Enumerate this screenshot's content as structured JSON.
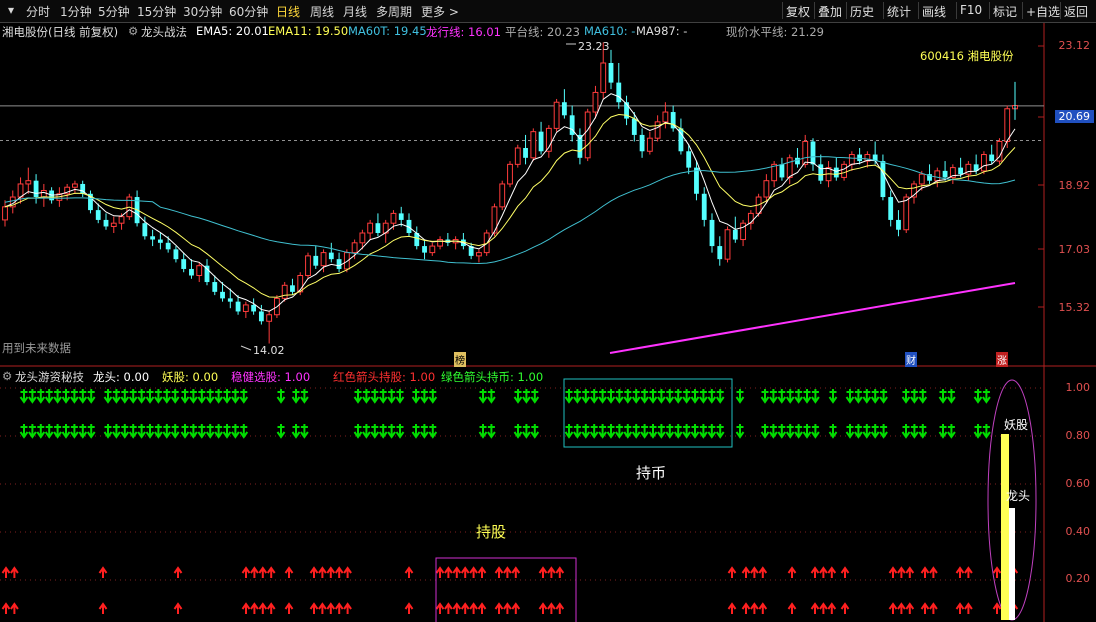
{
  "toolbar": {
    "periods": [
      "分时",
      "1分钟",
      "5分钟",
      "15分钟",
      "30分钟",
      "60分钟",
      "日线",
      "周线",
      "月线",
      "多周期",
      "更多"
    ],
    "active_period": "日线",
    "tools": [
      "复权",
      "叠加",
      "历史",
      "统计",
      "画线",
      "F10",
      "标记",
      "+自选",
      "返回"
    ]
  },
  "main": {
    "title": "湘电股份(日线 前复权)",
    "indicator_name": "龙头战法",
    "ema5": "EMA5: 20.01",
    "ema11": "EMA11: 19.50",
    "ma60t": "MA60T: 19.45",
    "longxing": "龙行线: 16.01",
    "pingtai": "平台线: 20.23",
    "ma610": "MA610: -",
    "ma987": "MA987: -",
    "xianjia": "现价水平线: 21.29",
    "stock_code_name": "600416  湘电股份",
    "high_label": "23.23",
    "low_label": "14.02",
    "future_data": "用到未来数据",
    "badge_bang": "榜",
    "badge_cai": "财",
    "badge_zhang": "涨",
    "price_axis": [
      "23.12",
      "20.69",
      "18.92",
      "17.03",
      "15.32"
    ],
    "current_price": "20.69"
  },
  "sub": {
    "indicator_name": "龙头游资秘技",
    "longtou": "龙头: 0.00",
    "yaogu": "妖股: 0.00",
    "wenjian": "稳健选股: 1.00",
    "hongse": "红色箭头持股: 1.00",
    "lvse": "绿色箭头持币: 1.00",
    "axis": [
      "1.00",
      "0.80",
      "0.60",
      "0.40",
      "0.20"
    ],
    "chibi_label": "持币",
    "chigu_label": "持股",
    "yaogu_bar_label": "妖股",
    "longtou_bar_label": "龙头"
  },
  "colors": {
    "up": "#ff3c3c",
    "down": "#54ffff",
    "yellow": "#ffff55",
    "magenta": "#ff33ff",
    "green_arrow": "#00dd00",
    "red_arrow": "#ff2020",
    "ma_white": "#ffffff",
    "ma_yellow": "#ffff66",
    "ma_cyan": "#40c0d0"
  },
  "chart_data": {
    "type": "candlestick",
    "ohlc": [
      [
        17.8,
        18.4,
        17.6,
        18.2
      ],
      [
        18.2,
        18.7,
        18.0,
        18.5
      ],
      [
        18.5,
        19.1,
        18.3,
        18.9
      ],
      [
        18.9,
        19.4,
        18.6,
        19.0
      ],
      [
        19.0,
        19.2,
        18.3,
        18.5
      ],
      [
        18.5,
        18.9,
        18.2,
        18.7
      ],
      [
        18.7,
        18.8,
        18.3,
        18.4
      ],
      [
        18.4,
        18.8,
        18.2,
        18.6
      ],
      [
        18.6,
        18.9,
        18.4,
        18.8
      ],
      [
        18.8,
        19.0,
        18.6,
        18.9
      ],
      [
        18.9,
        19.0,
        18.5,
        18.6
      ],
      [
        18.6,
        18.7,
        18.0,
        18.1
      ],
      [
        18.1,
        18.3,
        17.7,
        17.8
      ],
      [
        17.8,
        18.0,
        17.5,
        17.6
      ],
      [
        17.6,
        17.9,
        17.4,
        17.7
      ],
      [
        17.7,
        18.0,
        17.5,
        17.9
      ],
      [
        17.9,
        18.6,
        17.8,
        18.5
      ],
      [
        18.5,
        18.7,
        17.6,
        17.7
      ],
      [
        17.7,
        17.9,
        17.2,
        17.3
      ],
      [
        17.3,
        17.5,
        17.0,
        17.2
      ],
      [
        17.2,
        17.4,
        16.9,
        17.1
      ],
      [
        17.1,
        17.3,
        16.8,
        16.9
      ],
      [
        16.9,
        17.0,
        16.5,
        16.6
      ],
      [
        16.6,
        16.8,
        16.2,
        16.3
      ],
      [
        16.3,
        16.6,
        16.0,
        16.1
      ],
      [
        16.1,
        16.5,
        15.9,
        16.4
      ],
      [
        16.4,
        16.6,
        15.8,
        15.9
      ],
      [
        15.9,
        16.1,
        15.5,
        15.6
      ],
      [
        15.6,
        15.9,
        15.3,
        15.4
      ],
      [
        15.4,
        15.7,
        15.1,
        15.3
      ],
      [
        15.3,
        15.5,
        14.9,
        15.0
      ],
      [
        15.0,
        15.3,
        14.8,
        15.2
      ],
      [
        15.2,
        15.4,
        14.9,
        15.0
      ],
      [
        15.0,
        15.2,
        14.6,
        14.7
      ],
      [
        14.7,
        15.0,
        14.02,
        14.9
      ],
      [
        14.9,
        15.5,
        14.8,
        15.4
      ],
      [
        15.4,
        15.9,
        15.3,
        15.8
      ],
      [
        15.8,
        16.0,
        15.5,
        15.6
      ],
      [
        15.6,
        16.2,
        15.5,
        16.1
      ],
      [
        16.1,
        16.8,
        16.0,
        16.7
      ],
      [
        16.7,
        17.0,
        16.3,
        16.4
      ],
      [
        16.4,
        16.9,
        16.2,
        16.8
      ],
      [
        16.8,
        17.1,
        16.5,
        16.6
      ],
      [
        16.6,
        16.8,
        16.2,
        16.3
      ],
      [
        16.3,
        16.9,
        16.2,
        16.8
      ],
      [
        16.8,
        17.2,
        16.6,
        17.1
      ],
      [
        17.1,
        17.5,
        16.9,
        17.4
      ],
      [
        17.4,
        17.8,
        17.2,
        17.7
      ],
      [
        17.7,
        18.0,
        17.3,
        17.4
      ],
      [
        17.4,
        17.8,
        17.1,
        17.7
      ],
      [
        17.7,
        18.1,
        17.5,
        18.0
      ],
      [
        18.0,
        18.2,
        17.6,
        17.8
      ],
      [
        17.8,
        18.0,
        17.3,
        17.4
      ],
      [
        17.4,
        17.6,
        16.9,
        17.0
      ],
      [
        17.0,
        17.2,
        16.6,
        16.8
      ],
      [
        16.8,
        17.1,
        16.7,
        17.0
      ],
      [
        17.0,
        17.3,
        16.9,
        17.2
      ],
      [
        17.2,
        17.4,
        17.0,
        17.1
      ],
      [
        17.1,
        17.3,
        16.9,
        17.2
      ],
      [
        17.2,
        17.4,
        16.9,
        17.0
      ],
      [
        17.0,
        17.1,
        16.6,
        16.7
      ],
      [
        16.7,
        16.9,
        16.5,
        16.8
      ],
      [
        16.8,
        17.5,
        16.7,
        17.4
      ],
      [
        17.4,
        18.3,
        17.3,
        18.2
      ],
      [
        18.2,
        19.0,
        18.1,
        18.9
      ],
      [
        18.9,
        19.6,
        18.8,
        19.5
      ],
      [
        19.5,
        20.1,
        19.4,
        20.0
      ],
      [
        20.0,
        20.4,
        19.5,
        19.7
      ],
      [
        19.7,
        20.6,
        19.6,
        20.5
      ],
      [
        20.5,
        20.8,
        19.8,
        19.9
      ],
      [
        19.9,
        20.7,
        19.7,
        20.6
      ],
      [
        20.6,
        21.5,
        20.5,
        21.4
      ],
      [
        21.4,
        21.8,
        20.9,
        21.0
      ],
      [
        21.0,
        21.3,
        20.2,
        20.4
      ],
      [
        20.4,
        20.6,
        19.5,
        19.7
      ],
      [
        19.7,
        21.2,
        19.6,
        21.1
      ],
      [
        21.1,
        21.9,
        20.9,
        21.7
      ],
      [
        21.7,
        23.23,
        21.5,
        22.6
      ],
      [
        22.6,
        23.0,
        21.8,
        22.0
      ],
      [
        22.0,
        22.6,
        21.2,
        21.4
      ],
      [
        21.4,
        21.6,
        20.7,
        20.9
      ],
      [
        20.9,
        21.1,
        20.2,
        20.4
      ],
      [
        20.4,
        20.6,
        19.7,
        19.9
      ],
      [
        19.9,
        20.5,
        19.8,
        20.3
      ],
      [
        20.3,
        21.0,
        20.2,
        20.8
      ],
      [
        20.8,
        21.4,
        20.6,
        21.1
      ],
      [
        21.1,
        21.3,
        20.5,
        20.6
      ],
      [
        20.6,
        20.9,
        19.8,
        19.9
      ],
      [
        19.9,
        20.1,
        19.2,
        19.4
      ],
      [
        19.4,
        19.6,
        18.4,
        18.6
      ],
      [
        18.6,
        18.8,
        17.6,
        17.8
      ],
      [
        17.8,
        18.0,
        16.8,
        17.0
      ],
      [
        17.0,
        17.3,
        16.4,
        16.6
      ],
      [
        16.6,
        17.6,
        16.5,
        17.5
      ],
      [
        17.5,
        17.9,
        17.1,
        17.2
      ],
      [
        17.2,
        17.8,
        17.0,
        17.7
      ],
      [
        17.7,
        18.1,
        17.5,
        18.0
      ],
      [
        18.0,
        18.6,
        17.9,
        18.5
      ],
      [
        18.5,
        19.2,
        18.3,
        19.0
      ],
      [
        19.0,
        19.6,
        18.8,
        19.5
      ],
      [
        19.5,
        19.7,
        19.0,
        19.1
      ],
      [
        19.1,
        19.8,
        18.9,
        19.7
      ],
      [
        19.7,
        20.0,
        19.4,
        19.5
      ],
      [
        19.5,
        20.4,
        19.4,
        20.2
      ],
      [
        20.2,
        20.3,
        19.3,
        19.5
      ],
      [
        19.5,
        19.8,
        18.9,
        19.0
      ],
      [
        19.0,
        19.6,
        18.8,
        19.4
      ],
      [
        19.4,
        19.7,
        19.0,
        19.1
      ],
      [
        19.1,
        19.6,
        19.0,
        19.5
      ],
      [
        19.5,
        19.9,
        19.3,
        19.8
      ],
      [
        19.8,
        20.0,
        19.5,
        19.6
      ],
      [
        19.6,
        19.9,
        19.4,
        19.8
      ],
      [
        19.8,
        20.2,
        19.5,
        19.6
      ],
      [
        19.6,
        19.8,
        18.4,
        18.5
      ],
      [
        18.5,
        18.7,
        17.6,
        17.8
      ],
      [
        17.8,
        18.1,
        17.3,
        17.5
      ],
      [
        17.5,
        18.6,
        17.4,
        18.5
      ],
      [
        18.5,
        19.0,
        18.3,
        18.9
      ],
      [
        18.9,
        19.3,
        18.7,
        19.2
      ],
      [
        19.2,
        19.5,
        18.9,
        19.0
      ],
      [
        19.0,
        19.4,
        18.8,
        19.3
      ],
      [
        19.3,
        19.6,
        19.0,
        19.1
      ],
      [
        19.1,
        19.5,
        18.9,
        19.4
      ],
      [
        19.4,
        19.7,
        19.1,
        19.2
      ],
      [
        19.2,
        19.6,
        19.0,
        19.5
      ],
      [
        19.5,
        19.8,
        19.2,
        19.3
      ],
      [
        19.3,
        19.9,
        19.2,
        19.8
      ],
      [
        19.8,
        20.1,
        19.5,
        19.6
      ],
      [
        19.6,
        20.3,
        19.5,
        20.2
      ],
      [
        20.2,
        21.3,
        20.0,
        21.2
      ],
      [
        21.2,
        22.0,
        21.0,
        21.3
      ]
    ]
  }
}
